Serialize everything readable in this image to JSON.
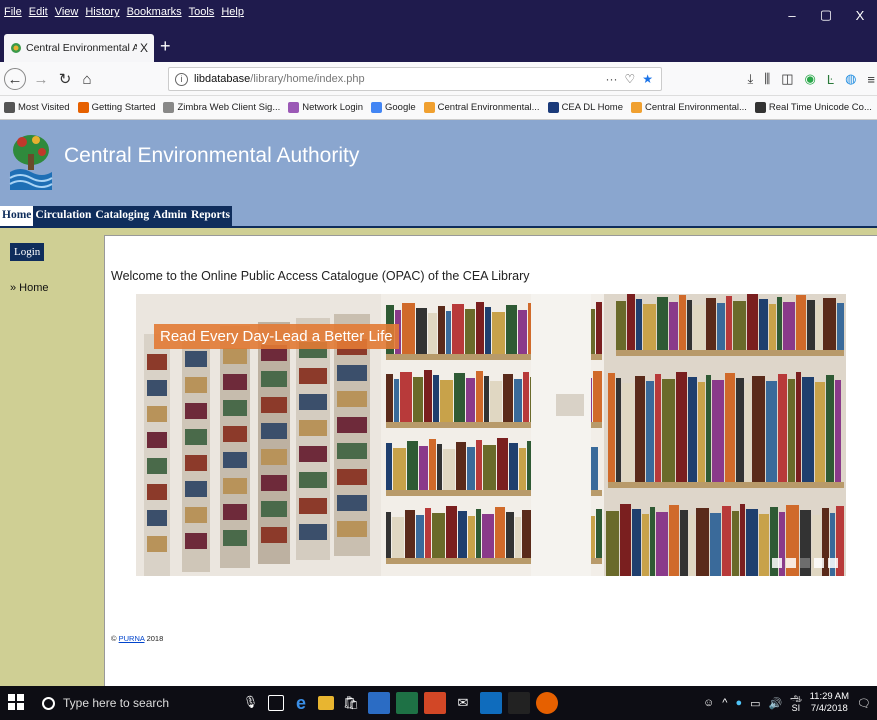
{
  "browser": {
    "menu": [
      "File",
      "Edit",
      "View",
      "History",
      "Bookmarks",
      "Tools",
      "Help"
    ],
    "window_buttons": [
      "–",
      "▢",
      "X"
    ],
    "tab_title": "Central Environmental Authorit",
    "tab_close": "X",
    "new_tab": "+",
    "url_host": "libdatabase",
    "url_path": "/library/home/index.php",
    "url_actions": [
      "···",
      "♡",
      "★"
    ],
    "bookmarks": [
      {
        "label": "Most Visited",
        "icon": "gear-icon",
        "color": "#555555"
      },
      {
        "label": "Getting Started",
        "icon": "firefox-icon",
        "color": "#e66000"
      },
      {
        "label": "Zimbra Web Client Sig...",
        "icon": "zimbra-icon",
        "color": "#888888"
      },
      {
        "label": "Network Login",
        "icon": "network-icon",
        "color": "#9b59b6"
      },
      {
        "label": "Google",
        "icon": "google-icon",
        "color": "#4285f4"
      },
      {
        "label": "Central Environmental...",
        "icon": "cea-icon",
        "color": "#f0a030"
      },
      {
        "label": "CEA DL Home",
        "icon": "dspace-icon",
        "color": "#1a3a7a"
      },
      {
        "label": "Central Environmental...",
        "icon": "cea-icon",
        "color": "#f0a030"
      },
      {
        "label": "Real Time Unicode Co...",
        "icon": "globe-icon",
        "color": "#333333"
      }
    ]
  },
  "site": {
    "title": "Central Environmental Authority",
    "nav": [
      "Home",
      "Circulation",
      "Cataloging",
      "Admin",
      "Reports"
    ],
    "active_nav": "Home",
    "login_label": "Login",
    "home_link": "» Home",
    "welcome": "Welcome to the Online Public Access Catalogue (OPAC) of the CEA Library",
    "banner_tagline": "Read Every Day-Lead a Better Life",
    "carousel_slides": 5,
    "carousel_active": 2,
    "footer_symbol": "©",
    "footer_link": "PURNA",
    "footer_year": "2018",
    "colors": {
      "header": "#8aa6cf",
      "nav": "#0f2d5c",
      "sidebar": "#cfcf94",
      "tagline": "#e27a34"
    }
  },
  "taskbar": {
    "search_placeholder": "Type here to search",
    "time": "11:29 AM",
    "date": "7/4/2018",
    "lang_top": "ஆ",
    "lang_bottom": "SI"
  }
}
